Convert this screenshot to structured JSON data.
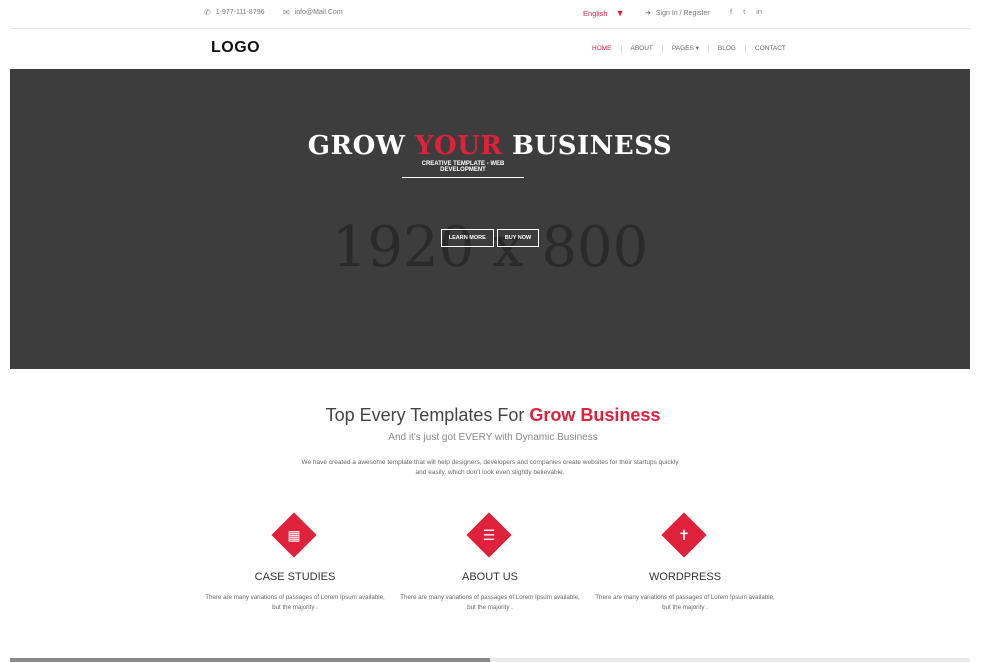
{
  "topbar": {
    "phone": "1-977-111-8796",
    "email": "info@Mail.Com",
    "language": "English",
    "signin": "Sign In / Register",
    "social": [
      "f",
      "t",
      "in"
    ]
  },
  "nav": {
    "logo": "LOGO",
    "items": [
      {
        "label": "HOME"
      },
      {
        "label": "ABOUT"
      },
      {
        "label": "PAGES ▾"
      },
      {
        "label": "BLOG"
      },
      {
        "label": "CONTACT"
      }
    ]
  },
  "hero": {
    "placeholder": "1920 x 800",
    "headline_1": "GROW ",
    "headline_2": "YOUR",
    "headline_3": " BUSINESS",
    "subtitle": "CREATIVE TEMPLATE - WEB DEVELOPMENT",
    "button_learn": "LEARN MORE",
    "button_buy": "BUY NOW"
  },
  "intro": {
    "title_a": "Top Every Templates For ",
    "title_b": "Grow Business",
    "subtitle": "And it's just got EVERY with Dynamic Business",
    "description": "We have created a awesome template that will help designers, developers and companies create websites for their startups quickly and easily. which don't look even slightly believable."
  },
  "features": [
    {
      "title": "CASE STUDIES",
      "desc": "There are many variations of passages of Lorem Ipsum available, but the majority .",
      "icon": "book-icon"
    },
    {
      "title": "ABOUT US",
      "desc": "There are many variations of passages of Lorem Ipsum available, but the majority .",
      "icon": "list-icon"
    },
    {
      "title": "WORDPRESS",
      "desc": "There are many variations of passages of Lorem Ipsum available, but the majority .",
      "icon": "wordpress-icon"
    }
  ],
  "colors": {
    "accent": "#e0213b",
    "hero_bg": "#3d3d3d"
  }
}
